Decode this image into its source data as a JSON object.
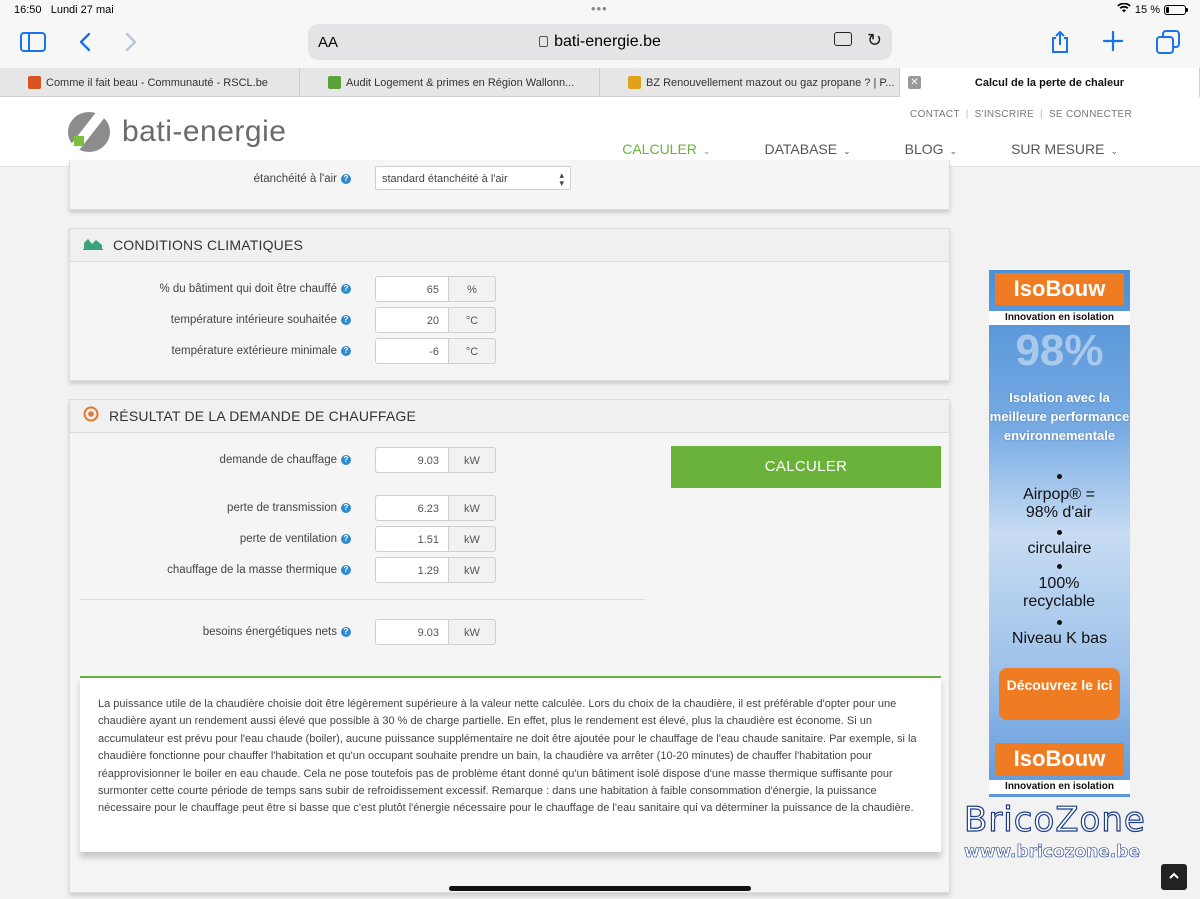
{
  "status": {
    "time": "16:50",
    "date": "Lundi 27 mai",
    "battery": "15 %",
    "battery_level": 0.15
  },
  "browser": {
    "aa": "AA",
    "url": "bati-energie.be",
    "tabs": [
      {
        "title": "Comme il fait beau - Communauté - RSCL.be",
        "fav_color": "#d9531e"
      },
      {
        "title": "Audit Logement & primes en Région Wallonn...",
        "fav_color": "#5aa33a"
      },
      {
        "title": "BZ Renouvellement mazout ou gaz propane ? | P...",
        "fav_color": "#e0a21a"
      },
      {
        "title": "Calcul de la perte de chaleur",
        "active": true
      }
    ]
  },
  "header": {
    "logo": "bati-energie",
    "top_links": [
      "CONTACT",
      "S'INSCRIRE",
      "SE CONNECTER"
    ],
    "nav": [
      {
        "label": "CALCULER",
        "active": true
      },
      {
        "label": "DATABASE"
      },
      {
        "label": "BLOG"
      },
      {
        "label": "SUR MESURE"
      }
    ]
  },
  "airtight": {
    "label": "étanchéité à l'air",
    "value": "standard étanchéité à l'air"
  },
  "climate": {
    "title": "CONDITIONS CLIMATIQUES",
    "rows": [
      {
        "label": "% du bâtiment qui doit être chauffé",
        "value": "65",
        "unit": "%"
      },
      {
        "label": "température intérieure souhaitée",
        "value": "20",
        "unit": "°C"
      },
      {
        "label": "température extérieure minimale",
        "value": "-6",
        "unit": "°C"
      }
    ]
  },
  "result": {
    "title": "RÉSULTAT DE LA DEMANDE DE CHAUFFAGE",
    "button": "CALCULER",
    "demand": {
      "label": "demande de chauffage",
      "value": "9.03",
      "unit": "kW"
    },
    "rows": [
      {
        "label": "perte de transmission",
        "value": "6.23",
        "unit": "kW"
      },
      {
        "label": "perte de ventilation",
        "value": "1.51",
        "unit": "kW"
      },
      {
        "label": "chauffage de la masse thermique",
        "value": "1.29",
        "unit": "kW"
      }
    ],
    "net": {
      "label": "besoins énergétiques nets",
      "value": "9.03",
      "unit": "kW"
    },
    "note": "La puissance utile de la chaudière choisie doit être légèrement supérieure à la valeur nette calculée. Lors du choix de la chaudière, il est préférable d'opter pour une chaudière ayant un rendement aussi élevé que possible à 30 % de charge partielle. En effet, plus le rendement est élevé, plus la chaudière est économe. Si un accumulateur est prévu pour l'eau chaude (boiler), aucune puissance supplémentaire ne doit être ajoutée pour le chauffage de l'eau chaude sanitaire. Par exemple, si la chaudière fonctionne pour chauffer l'habitation et qu'un occupant souhaite prendre un bain, la chaudière va arrêter (10-20 minutes) de chauffer l'habitation pour réapprovisionner le boiler en eau chaude. Cela ne pose toutefois pas de problème étant donné qu'un bâtiment isolé dispose d'une masse thermique suffisante pour surmonter cette courte période de temps sans subir de refroidissement excessif. Remarque : dans une habitation à faible consommation d'énergie, la puissance nécessaire pour le chauffage peut être si basse que c'est plutôt l'énergie nécessaire pour le chauffage de l'eau sanitaire qui va déterminer la puissance de la chaudière."
  },
  "ad": {
    "brand": "IsoBouw",
    "tagline": "Innovation en isolation",
    "big": "98%",
    "claim": "Isolation avec la meilleure performance environnementale",
    "features": [
      "Airpop® = 98% d'air",
      "circulaire",
      "100% recyclable",
      "Niveau K bas"
    ],
    "cta": "Découvrez le ici"
  },
  "watermark": {
    "name": "BricoZone",
    "site": "www.bricozone.be"
  },
  "colors": {
    "accent": "#6ab23a",
    "help": "#2e8bd0",
    "ad_orange": "#ef7c22"
  }
}
